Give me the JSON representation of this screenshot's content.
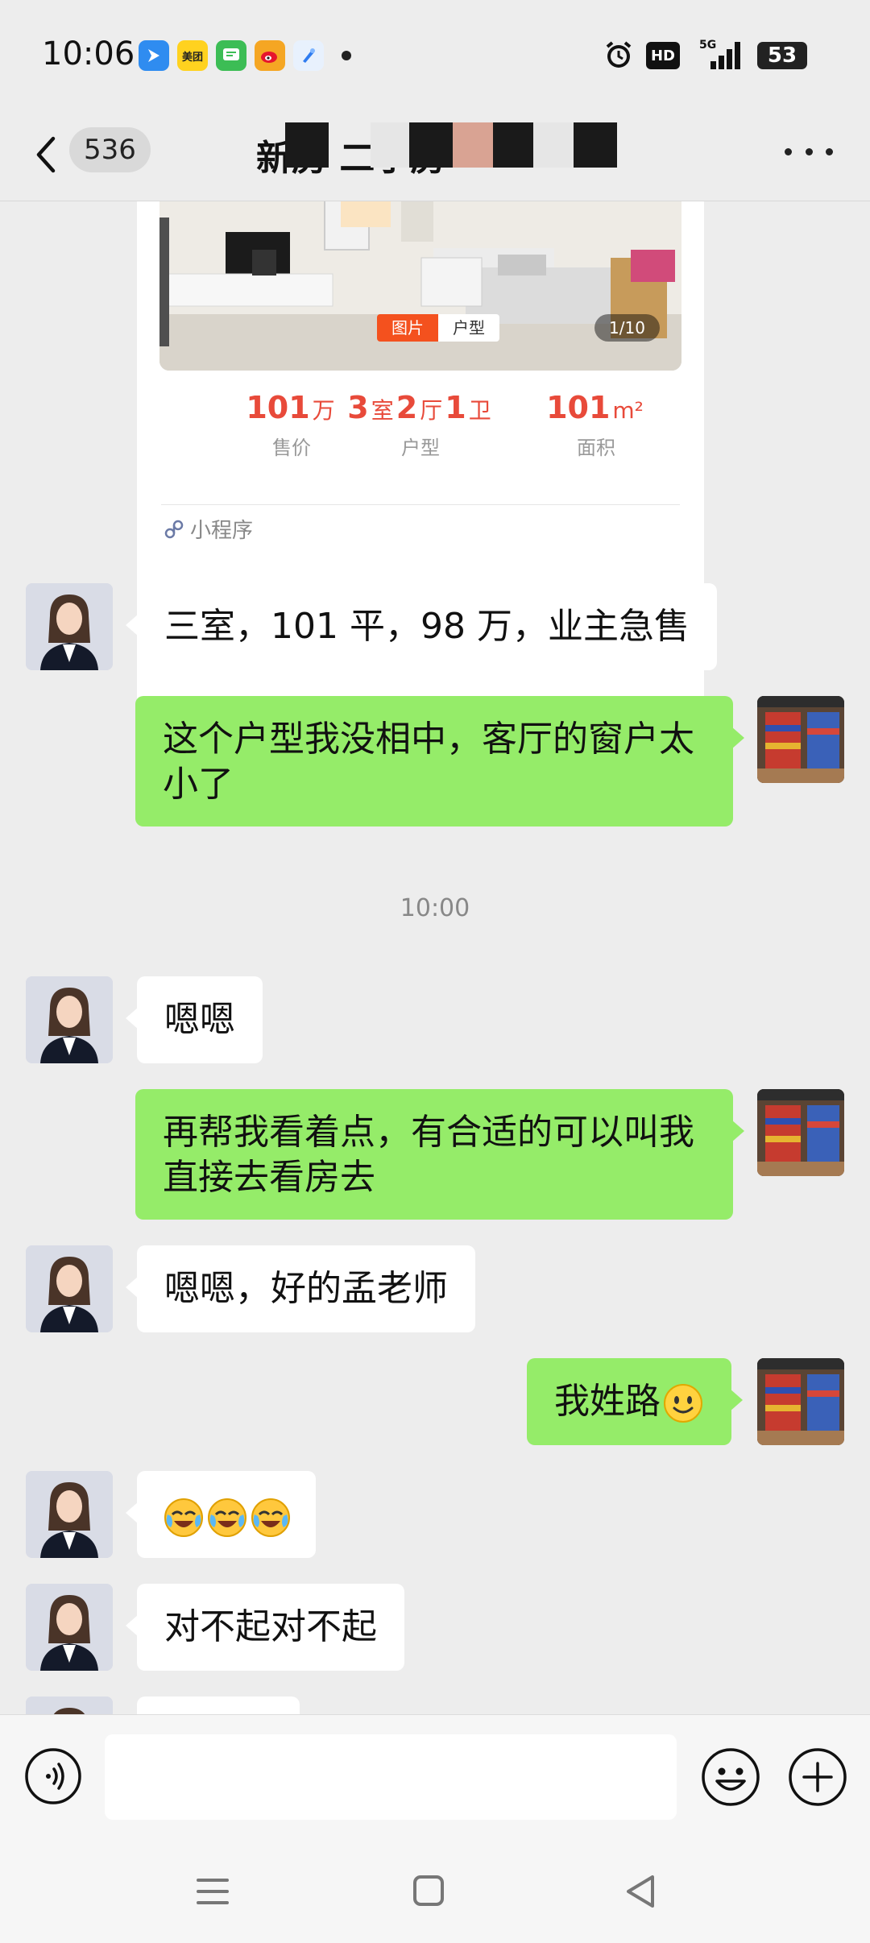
{
  "status_bar": {
    "time": "10:06",
    "apps": [
      {
        "icon": "maps-app-icon",
        "color": "#2f8cf0",
        "label": ""
      },
      {
        "icon": "meituan-app-icon",
        "color": "#ffd21f",
        "label": "美团"
      },
      {
        "icon": "messages-app-icon",
        "color": "#3cbd55",
        "label": ""
      },
      {
        "icon": "weibo-app-icon",
        "color": "#f5a623",
        "label": ""
      },
      {
        "icon": "browser-app-icon",
        "color": "#4a9cf5",
        "label": ""
      }
    ],
    "hd": "HD",
    "network": "5G",
    "battery": "53"
  },
  "header": {
    "back_icon": "chevron-left-icon",
    "unread_count": "536",
    "title": "新房 二手房"
  },
  "listing_card": {
    "photo_tabs": [
      "图片",
      "户型"
    ],
    "photo_count": "1/10",
    "price": {
      "value": "101",
      "unit": "万",
      "label": "售价"
    },
    "layout": {
      "rooms": "3",
      "rooms_unit": "室",
      "halls": "2",
      "halls_unit": "厅",
      "baths": "1",
      "baths_unit": "卫",
      "label": "户型"
    },
    "area": {
      "value": "101",
      "unit": "m²",
      "label": "面积"
    },
    "mini_program": "小程序"
  },
  "messages": {
    "m1": "三室，101 平，98 万，业主急售",
    "m2_line1": "这个户型我没相中，客厅的窗户太",
    "m2_line2": "小了",
    "time1": "10:00",
    "m3": "嗯嗯",
    "m4_line1": "再帮我看着点，有合适的可以叫我",
    "m4_line2": "直接去看房去",
    "m5": "嗯嗯，好的孟老师",
    "m6": "我姓路",
    "m6_emoji": "smile-emoji-icon",
    "m7_emoji": "laugh-cry-emoji-icon",
    "m8": "对不起对不起"
  },
  "input_bar": {
    "placeholder": "",
    "voice_icon": "voice-icon",
    "emoji_icon": "emoji-icon",
    "plus_icon": "plus-icon"
  },
  "nav_bar": {
    "icons": [
      "menu-icon",
      "home-icon",
      "back-icon"
    ]
  },
  "colors": {
    "background": "#ededed",
    "bubble_out": "#95ec69",
    "bubble_in": "#ffffff",
    "price_red": "#e84a3a",
    "tab_orange": "#f4511e"
  }
}
